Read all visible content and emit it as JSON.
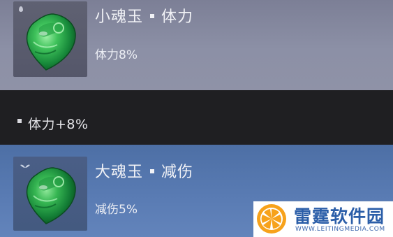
{
  "items": [
    {
      "name": "小魂玉",
      "stat": "体力",
      "description": "体力8%",
      "theme_color": "#8c90a6",
      "icon": "green-jade-shield-icon"
    },
    {
      "name": "大魂玉",
      "stat": "减伤",
      "description": "减伤5%",
      "theme_color": "#5a7cb4",
      "icon": "green-jade-shield-icon"
    }
  ],
  "bonus_line": "体力+8%",
  "watermark": {
    "name": "雷霆软件园",
    "url": "WWW.LEITINGMEDIA.COM"
  }
}
